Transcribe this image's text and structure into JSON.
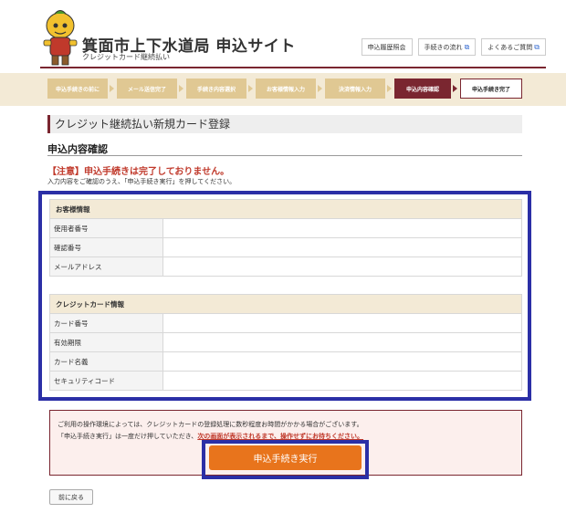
{
  "header": {
    "title": "箕面市上下水道局 申込サイト",
    "subtitle": "クレジットカード継続払い",
    "links": [
      {
        "label": "申込履歴照会",
        "external": false
      },
      {
        "label": "手続きの流れ",
        "external": true
      },
      {
        "label": "よくあるご質問",
        "external": true
      }
    ],
    "external_icon": "external-link-icon"
  },
  "steps": [
    {
      "label": "申込手続きの前に"
    },
    {
      "label": "メール送信完了"
    },
    {
      "label": "手続き内容選択"
    },
    {
      "label": "お客様情報入力"
    },
    {
      "label": "決済情報入力"
    },
    {
      "label": "申込内容確認"
    },
    {
      "label": "申込手続き完了"
    }
  ],
  "page": {
    "title": "クレジット継続払い新規カード登録",
    "section": "申込内容確認",
    "warning": "【注意】申込手続きは完了しておりません。",
    "instruction": "入力内容をご確認のうえ、「申込手続き実行」を押してください。"
  },
  "customer": {
    "heading": "お客様情報",
    "rows": [
      {
        "label": "使用者番号",
        "value": ""
      },
      {
        "label": "確認番号",
        "value": ""
      },
      {
        "label": "メールアドレス",
        "value": ""
      }
    ]
  },
  "card": {
    "heading": "クレジットカード情報",
    "rows": [
      {
        "label": "カード番号",
        "value": ""
      },
      {
        "label": "有効期限",
        "value": ""
      },
      {
        "label": "カード名義",
        "value": ""
      },
      {
        "label": "セキュリティコード",
        "value": ""
      }
    ]
  },
  "notice": {
    "line1": "ご利用の操作環境によっては、クレジットカードの登録処理に数秒程度お時間がかかる場合がございます。",
    "line2_prefix": "「申込手続き実行」は一度だけ押していただき、",
    "line2_emphasis": "次の画面が表示されるまで、操作せずにお待ちください。"
  },
  "buttons": {
    "execute": "申込手続き実行",
    "back": "前に戻る"
  },
  "colors": {
    "brand": "#7a2630",
    "step_inactive": "#e0c893",
    "highlight_frame": "#2b2fa6",
    "execute_button": "#e8741c",
    "warning": "#c0392b"
  }
}
